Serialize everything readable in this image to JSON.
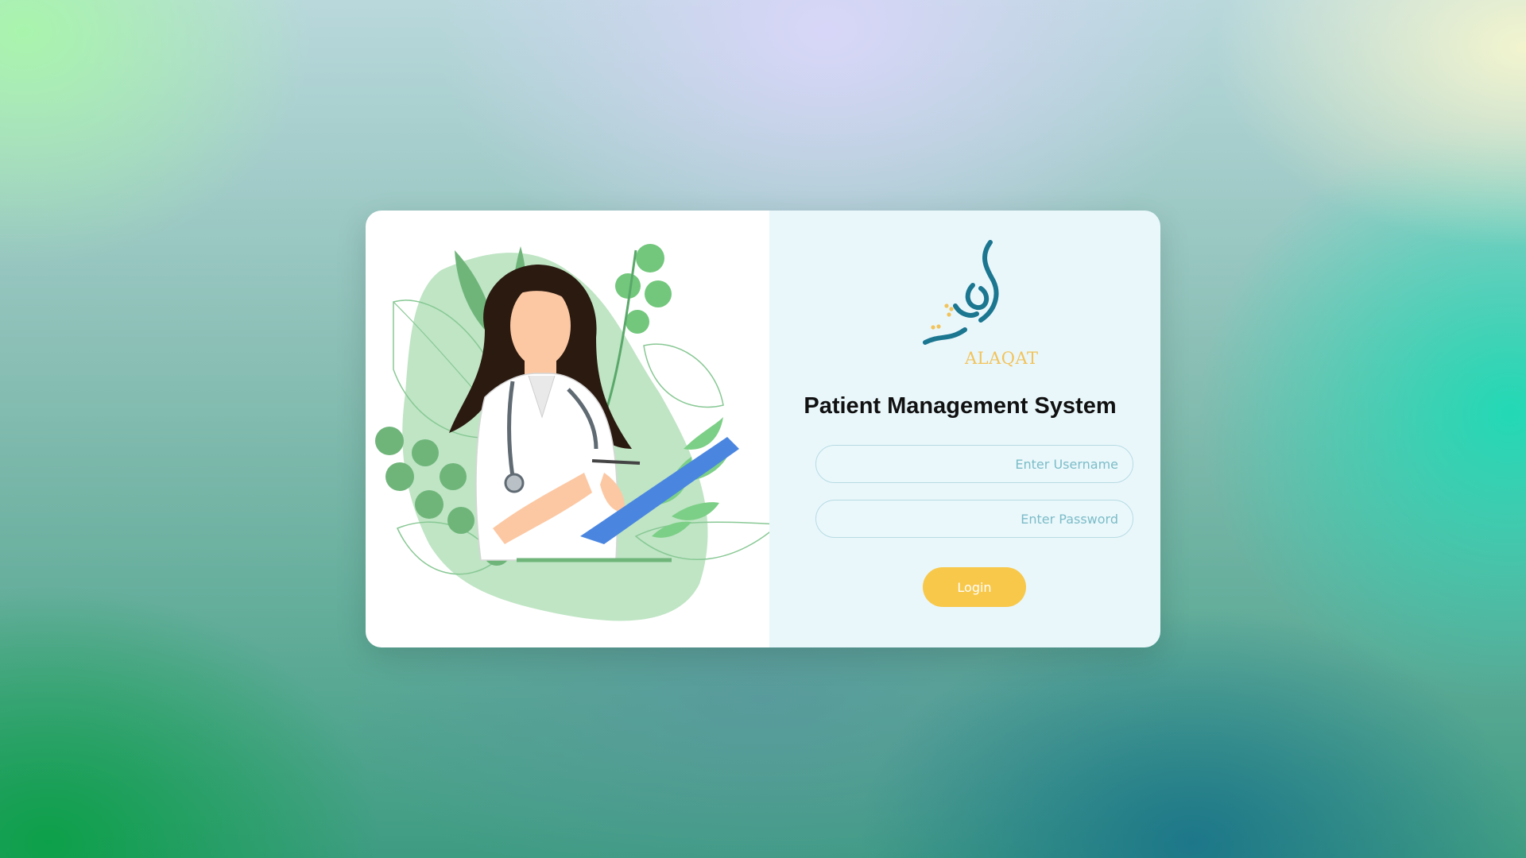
{
  "brand": {
    "name": "ALAQAT",
    "colors": {
      "teal": "#1b7690",
      "gold": "#f2c35a"
    }
  },
  "login": {
    "title": "Patient Management System",
    "username_placeholder": "Enter Username",
    "password_placeholder": "Enter Password",
    "login_label": "Login"
  },
  "illustration": {
    "icon": "doctor-with-clipboard-illustration"
  },
  "colors": {
    "accent": "#f8c84a",
    "panel": "#e9f7fb",
    "leaf": "#6cc37a"
  }
}
